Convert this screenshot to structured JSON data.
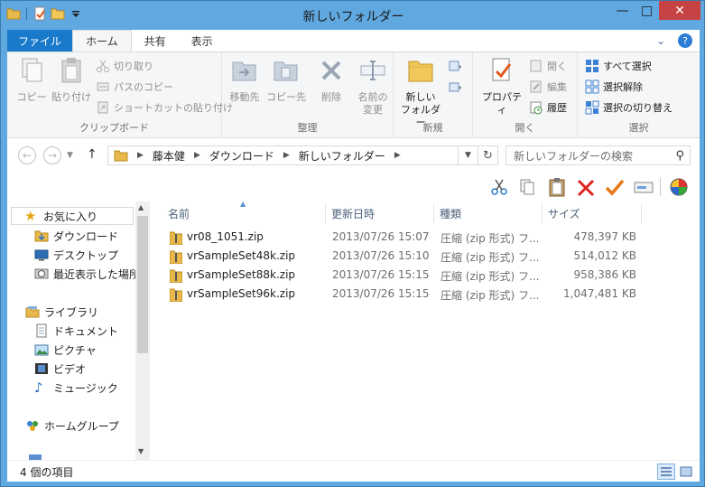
{
  "window": {
    "title": "新しいフォルダー"
  },
  "ribbon_tabs": {
    "file": "ファイル",
    "home": "ホーム",
    "share": "共有",
    "view": "表示"
  },
  "clipboard": {
    "copy": "コピー",
    "paste": "貼り付け",
    "cut": "切り取り",
    "copy_path": "パスのコピー",
    "paste_shortcut": "ショートカットの貼り付け",
    "label": "クリップボード"
  },
  "organize": {
    "move_to": "移動先",
    "copy_to": "コピー先",
    "delete": "削除",
    "rename_line1": "名前の",
    "rename_line2": "変更",
    "label": "整理"
  },
  "new": {
    "new_folder_line1": "新しい",
    "new_folder_line2": "フォルダー",
    "label": "新規"
  },
  "open": {
    "properties": "プロパティ",
    "open": "開く",
    "edit": "編集",
    "history": "履歴",
    "label": "開く"
  },
  "select": {
    "select_all": "すべて選択",
    "select_none": "選択解除",
    "invert": "選択の切り替え",
    "label": "選択"
  },
  "address": {
    "crumbs": [
      "藤本健",
      "ダウンロード",
      "新しいフォルダー"
    ]
  },
  "search": {
    "placeholder": "新しいフォルダーの検索"
  },
  "nav": {
    "favorites": "お気に入り",
    "downloads": "ダウンロード",
    "desktop": "デスクトップ",
    "recent": "最近表示した場所",
    "libraries": "ライブラリ",
    "documents": "ドキュメント",
    "pictures": "ピクチャ",
    "videos": "ビデオ",
    "music": "ミュージック",
    "homegroup": "ホームグループ"
  },
  "columns": {
    "name": "名前",
    "date": "更新日時",
    "type": "種類",
    "size": "サイズ"
  },
  "files": [
    {
      "name": "vr08_1051.zip",
      "date": "2013/07/26 15:07",
      "type": "圧縮 (zip 形式) フ...",
      "size": "478,397 KB"
    },
    {
      "name": "vrSampleSet48k.zip",
      "date": "2013/07/26 15:10",
      "type": "圧縮 (zip 形式) フ...",
      "size": "514,012 KB"
    },
    {
      "name": "vrSampleSet88k.zip",
      "date": "2013/07/26 15:15",
      "type": "圧縮 (zip 形式) フ...",
      "size": "958,386 KB"
    },
    {
      "name": "vrSampleSet96k.zip",
      "date": "2013/07/26 15:15",
      "type": "圧縮 (zip 形式) フ...",
      "size": "1,047,481 KB"
    }
  ],
  "status": {
    "count": "4 個の項目"
  },
  "colors": {
    "title_bar": "#5fa8e0",
    "file_tab": "#1979ca",
    "close": "#c74343"
  }
}
